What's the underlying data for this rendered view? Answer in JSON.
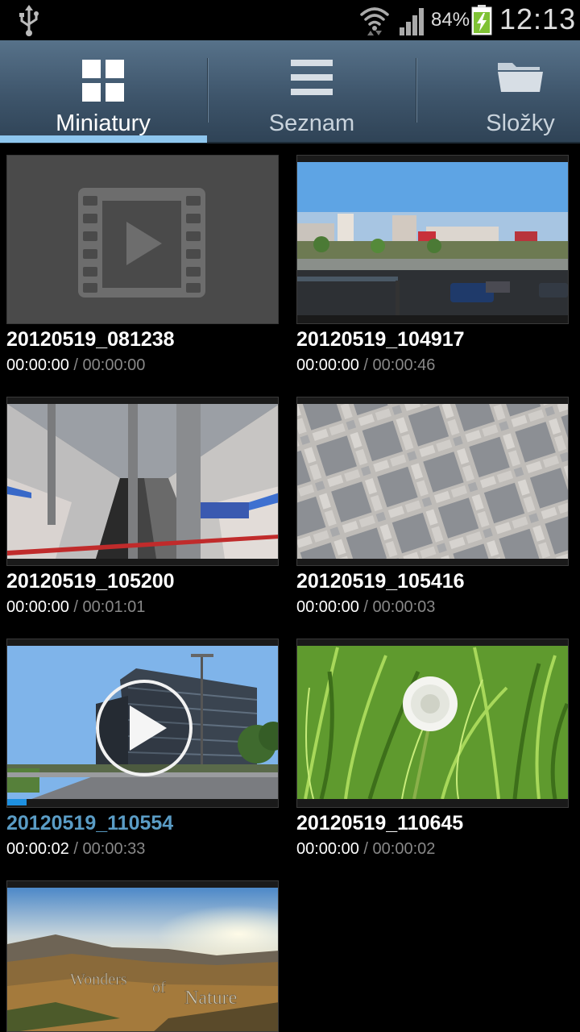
{
  "status_bar": {
    "battery_percent": "84%",
    "time": "12:13",
    "usb_icon": "usb-icon",
    "wifi_icon": "wifi-icon",
    "signal_icon": "signal-icon",
    "battery_icon": "battery-charging-icon"
  },
  "tabs": [
    {
      "label": "Miniatury",
      "icon": "grid-icon",
      "active": true
    },
    {
      "label": "Seznam",
      "icon": "list-icon",
      "active": false
    },
    {
      "label": "Složky",
      "icon": "folder-icon",
      "active": false
    }
  ],
  "videos": [
    {
      "title": "20120519_081238",
      "position": "00:00:00",
      "separator": " / ",
      "duration": "00:00:00",
      "thumbnail": "placeholder-film-icon"
    },
    {
      "title": "20120519_104917",
      "position": "00:00:00",
      "separator": " / ",
      "duration": "00:00:46",
      "thumbnail": "street-scene"
    },
    {
      "title": "20120519_105200",
      "position": "00:00:00",
      "separator": " / ",
      "duration": "00:01:01",
      "thumbnail": "metro-station"
    },
    {
      "title": "20120519_105416",
      "position": "00:00:00",
      "separator": " / ",
      "duration": "00:00:03",
      "thumbnail": "paving-stones"
    },
    {
      "title": "20120519_110554",
      "position": "00:00:02",
      "separator": " / ",
      "duration": "00:00:33",
      "thumbnail": "office-building",
      "playing": true,
      "progress_fraction": 0.07
    },
    {
      "title": "20120519_110645",
      "position": "00:00:00",
      "separator": " / ",
      "duration": "00:00:02",
      "thumbnail": "dandelion"
    },
    {
      "thumbnail": "landscape-sunset",
      "overlay_text": [
        "Wonders",
        "of",
        "Nature"
      ]
    }
  ],
  "colors": {
    "active_tab_indicator": "#8ec6ee",
    "highlight_title": "#5a9cc5",
    "progress": "#1e90e0"
  }
}
